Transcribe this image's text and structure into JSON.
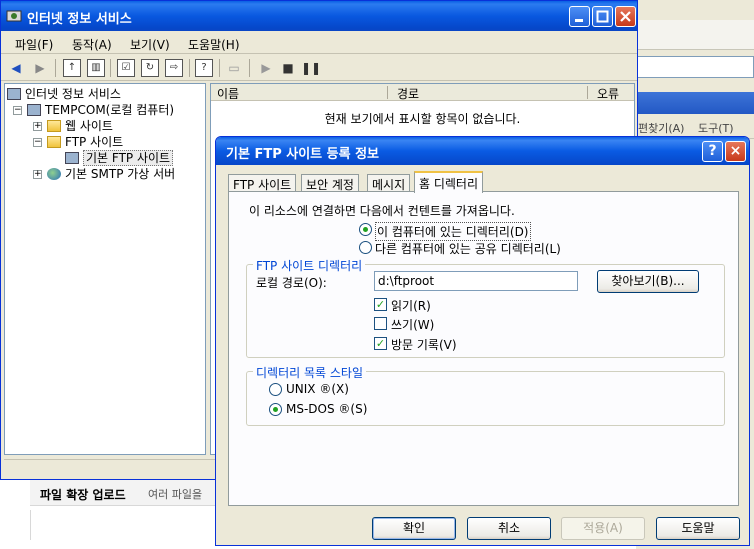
{
  "background": {
    "menu": [
      "편찾기(A)",
      "도구(T)"
    ],
    "bottom_title": "파일 확장 업로드",
    "bottom_sub": "여러 파일을"
  },
  "window": {
    "title": "인터넷 정보 서비스",
    "menu": [
      "파일(F)",
      "동작(A)",
      "보기(V)",
      "도움말(H)"
    ],
    "tree": [
      {
        "label": "인터넷 정보 서비스"
      },
      {
        "label": "TEMPCOM(로컬 컴퓨터)"
      },
      {
        "label": "웹 사이트"
      },
      {
        "label": "FTP 사이트"
      },
      {
        "label": "기본 FTP 사이트"
      },
      {
        "label": "기본 SMTP 가상 서버"
      }
    ],
    "columns": [
      "이름",
      "경로",
      "오류"
    ],
    "empty_text": "현재 보기에서 표시할 항목이 없습니다."
  },
  "dialog": {
    "title": "기본 FTP 사이트 등록 정보",
    "help_glyph": "?",
    "close_glyph": "×",
    "tabs": [
      "FTP 사이트",
      "보안 계정",
      "메시지",
      "홈 디렉터리"
    ],
    "active_tab": "홈 디렉터리",
    "source_label": "이 리소스에 연결하면 다음에서 컨텐트를 가져옵니다.",
    "source_options": [
      {
        "label": "이 컴퓨터에 있는 디렉터리(D)",
        "selected": true
      },
      {
        "label": "다른 컴퓨터에 있는 공유 디렉터리(L)",
        "selected": false
      }
    ],
    "ftp_dir_group": "FTP 사이트 디렉터리",
    "local_path_label": "로컬 경로(O):",
    "local_path_value": "d:\\ftproot",
    "browse_button": "찾아보기(B)...",
    "permissions": [
      {
        "label": "읽기(R)",
        "checked": true
      },
      {
        "label": "쓰기(W)",
        "checked": false
      },
      {
        "label": "방문 기록(V)",
        "checked": true
      }
    ],
    "listing_group": "디렉터리 목록 스타일",
    "listing_options": [
      {
        "label": "UNIX ®(X)",
        "selected": false
      },
      {
        "label": "MS-DOS ®(S)",
        "selected": true
      }
    ],
    "buttons": {
      "ok": "확인",
      "cancel": "취소",
      "apply": "적용(A)",
      "help": "도움말"
    }
  }
}
